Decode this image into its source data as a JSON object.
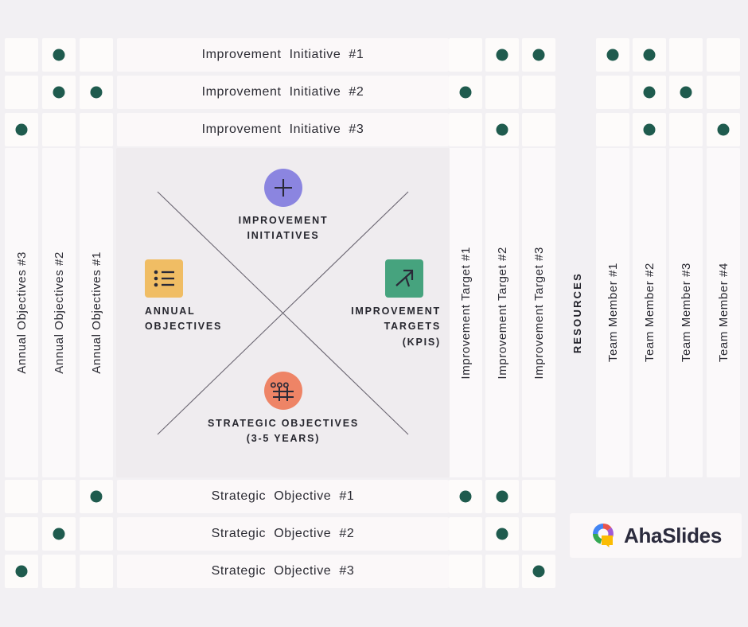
{
  "title": "Hoshin Kanri X-Matrix",
  "colors": {
    "page_background": "#f2f0f3",
    "cell_background": "#fdfbfa",
    "center_panel": "#efecef",
    "dot": "#1f5b4e",
    "improvement_initiatives_icon": "#8b85e0",
    "annual_objectives_icon": "#f0bd64",
    "improvement_targets_icon": "#46a37e",
    "strategic_objectives_icon": "#ee8466",
    "text": "#2b2b33"
  },
  "center": {
    "top": {
      "title": "IMPROVEMENT\nINITIATIVES",
      "line1": "IMPROVEMENT",
      "line2": "INITIATIVES",
      "icon": "plus-icon"
    },
    "left": {
      "line1": "ANNUAL",
      "line2": "OBJECTIVES",
      "icon": "bulleted-list-icon"
    },
    "right": {
      "line1": "IMPROVEMENT",
      "line2": "TARGETS",
      "line3": "(KPIS)",
      "icon": "rising-arrow-icon"
    },
    "bottom": {
      "line1": "STRATEGIC OBJECTIVES",
      "line2": "(3-5 YEARS)",
      "icon": "grid-target-icon"
    }
  },
  "top_rows": [
    {
      "label": "Improvement  Initiative  #1",
      "annual_objectives": [
        false,
        true,
        false
      ],
      "improvement_targets": [
        false,
        true,
        true
      ],
      "team_members": [
        true,
        true,
        false,
        false
      ]
    },
    {
      "label": "Improvement  Initiative  #2",
      "annual_objectives": [
        false,
        true,
        true
      ],
      "improvement_targets": [
        true,
        false,
        false
      ],
      "team_members": [
        false,
        true,
        true,
        false
      ]
    },
    {
      "label": "Improvement  Initiative  #3",
      "annual_objectives": [
        true,
        false,
        false
      ],
      "improvement_targets": [
        false,
        true,
        false
      ],
      "team_members": [
        false,
        true,
        false,
        true
      ]
    }
  ],
  "bottom_rows": [
    {
      "label": "Strategic  Objective  #1",
      "annual_objectives": [
        false,
        false,
        true
      ],
      "improvement_targets": [
        true,
        true,
        false
      ]
    },
    {
      "label": "Strategic  Objective  #2",
      "annual_objectives": [
        false,
        true,
        false
      ],
      "improvement_targets": [
        false,
        true,
        false
      ]
    },
    {
      "label": "Strategic  Objective  #3",
      "annual_objectives": [
        true,
        false,
        false
      ],
      "improvement_targets": [
        false,
        false,
        true
      ]
    }
  ],
  "left_columns": [
    "Annual Objectives #3",
    "Annual Objectives #2",
    "Annual Objectives #1"
  ],
  "target_columns": [
    "Improvement Target #1",
    "Improvement Target #2",
    "Improvement Target #3"
  ],
  "resources_label": "RESOURCES",
  "team_columns": [
    "Team Member #1",
    "Team Member #2",
    "Team Member #3",
    "Team Member #4"
  ],
  "logo": {
    "wordmark": "AhaSlides",
    "mark": "ahaslides-donut-icon"
  }
}
